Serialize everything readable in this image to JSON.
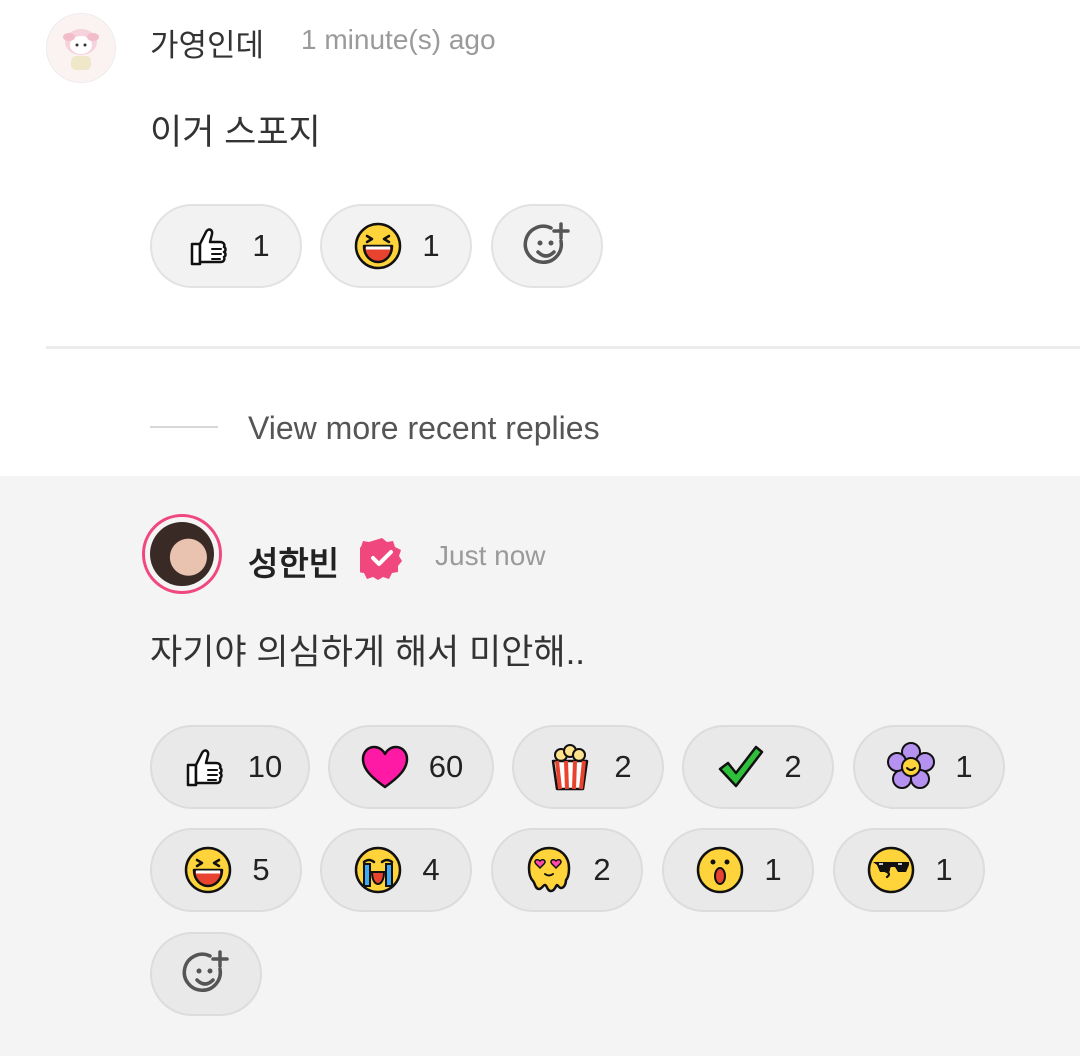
{
  "comment": {
    "username": "가영인데",
    "timestamp": "1 minute(s) ago",
    "text": "이거 스포지",
    "reactions": [
      {
        "icon": "thumbs-up-emoji",
        "count": "1"
      },
      {
        "icon": "laughing-emoji",
        "count": "1"
      }
    ],
    "add_reaction_icon": "add-reaction-icon"
  },
  "view_more": {
    "label": "View more recent replies"
  },
  "reply": {
    "username": "성한빈",
    "verified_icon": "verified-badge-icon",
    "timestamp": "Just now",
    "text": "자기야 의심하게 해서 미안해..",
    "reactions": [
      {
        "icon": "thumbs-up-emoji",
        "count": "10"
      },
      {
        "icon": "heart-emoji",
        "count": "60"
      },
      {
        "icon": "popcorn-emoji",
        "count": "2"
      },
      {
        "icon": "checkmark-emoji",
        "count": "2"
      },
      {
        "icon": "flower-emoji",
        "count": "1"
      },
      {
        "icon": "laughing-emoji",
        "count": "5"
      },
      {
        "icon": "crying-emoji",
        "count": "4"
      },
      {
        "icon": "melting-heart-eyes-emoji",
        "count": "2"
      },
      {
        "icon": "surprised-emoji",
        "count": "1"
      },
      {
        "icon": "sunglasses-kiss-emoji",
        "count": "1"
      }
    ],
    "add_reaction_icon": "add-reaction-icon"
  },
  "colors": {
    "accent_pink": "#f0487e",
    "pill_bg": "#f2f2f2",
    "reply_bg": "#f4f4f4"
  }
}
